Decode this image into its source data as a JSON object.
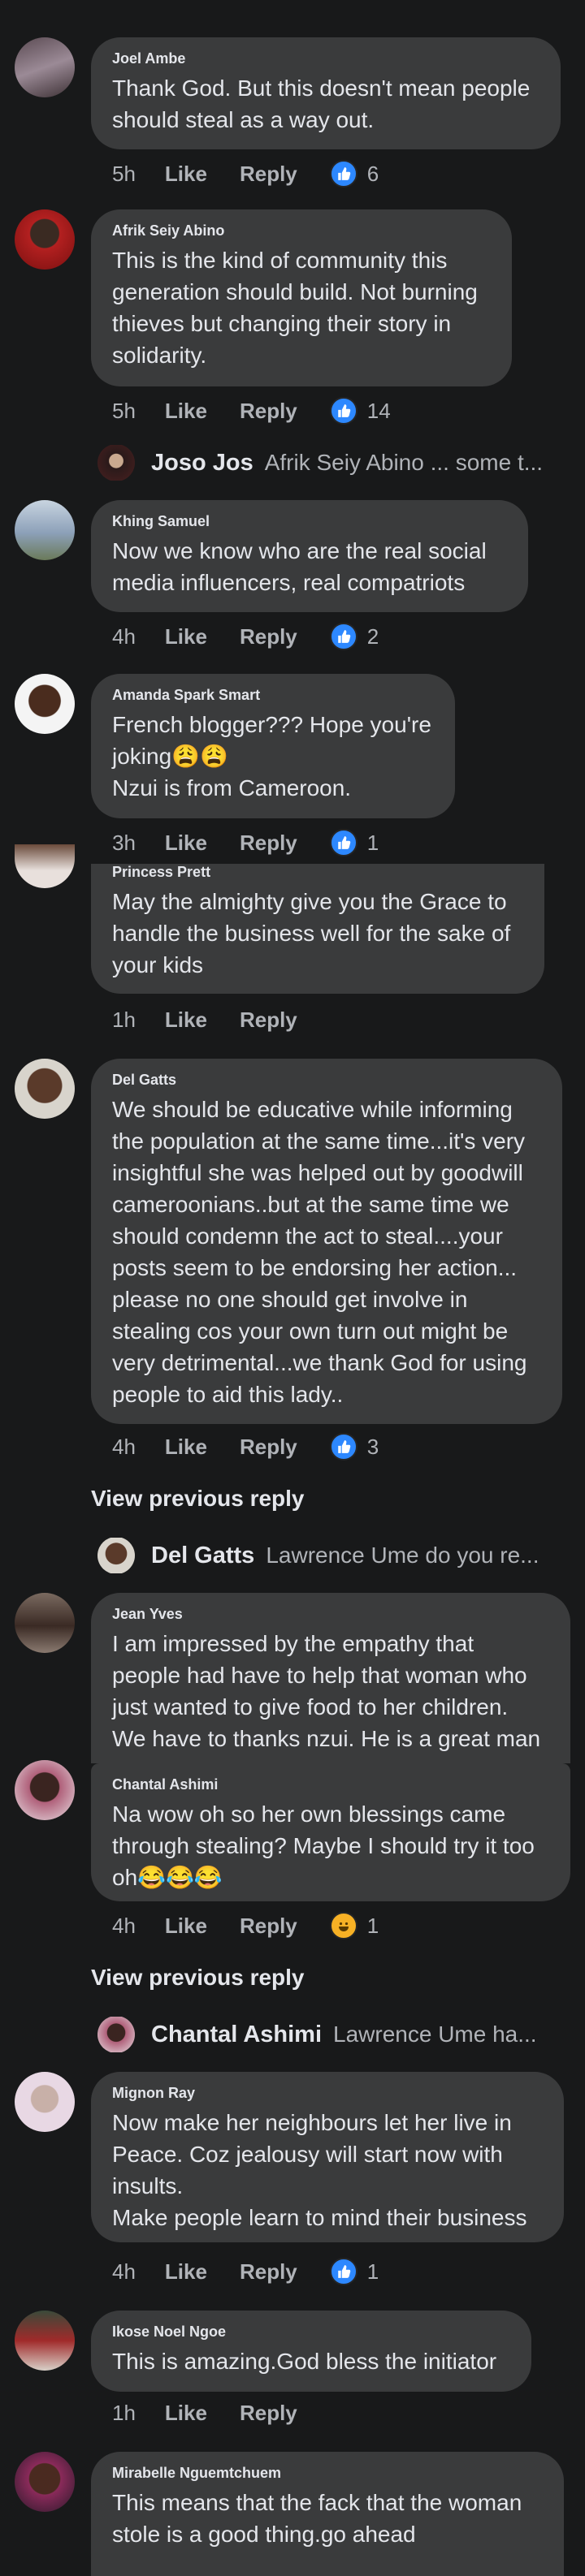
{
  "labels": {
    "like": "Like",
    "reply": "Reply"
  },
  "comments": [
    {
      "name": "Joel Ambe",
      "text": "Thank God. But this doesn't mean people\nshould steal as a way out.",
      "time": "5h",
      "reaction_count": "6"
    },
    {
      "name": "Afrik Seiy Abino",
      "text": "This is the kind of community this\ngeneration should build. Not burning\nthieves but changing their story in\nsolidarity.",
      "time": "5h",
      "reaction_count": "14"
    },
    {
      "name": "Khing Samuel",
      "text": "Now we know who are the real  social\nmedia influencers, real compatriots",
      "time": "4h",
      "reaction_count": "2"
    },
    {
      "name": "Amanda Spark Smart",
      "text": "French blogger??? Hope you're\njoking😩😩\nNzui is from Cameroon.",
      "time": "3h",
      "reaction_count": "1"
    },
    {
      "name": "Princess Prett",
      "text": "May the almighty give you the Grace to\nhandle the business well for the sake of\nyour kids",
      "time": "1h"
    },
    {
      "name": "Del Gatts",
      "text": "We should be educative while informing\nthe population at the same time...it's very\ninsightful she was helped out by goodwill\ncameroonians..but at the same time we\nshould condemn the act to steal....your\nposts seem to be endorsing her action...\nplease no one should get involve in\nstealing cos your own turn out might be\nvery detrimental...we thank God for using\npeople to aid this lady..",
      "time": "4h",
      "reaction_count": "3"
    },
    {
      "name": "Jean Yves",
      "text": "I am impressed by the empathy that\npeople had have to help that woman who\njust wanted to give food to her children.\nWe have to thanks nzui. He is a great man"
    },
    {
      "name": "Chantal Ashimi",
      "text": "Na wow oh so her own blessings came\nthrough stealing? Maybe I should try it too\noh😂😂😂",
      "time": "4h",
      "reaction_count": "1"
    },
    {
      "name": "Mignon Ray",
      "text": "Now make her neighbours let her live in\nPeace. Coz jealousy will start now with\ninsults.\nMake people learn to mind their business",
      "time": "4h",
      "reaction_count": "1"
    },
    {
      "name": "Ikose Noel Ngoe",
      "text": "This is amazing.God bless the initiator",
      "time": "1h"
    },
    {
      "name": "Mirabelle Nguemtchuem",
      "text": "This means that the fack that the woman\nstole is a good thing.go ahead"
    }
  ],
  "replies": [
    {
      "name": "Joso Jos",
      "text": "Afrik Seiy Abino ... some t..."
    },
    {
      "name": "Del Gatts",
      "text": "Lawrence Ume do you re..."
    },
    {
      "name": "Chantal Ashimi",
      "text": "Lawrence Ume  ha..."
    }
  ],
  "view_previous": "View previous reply",
  "colors": {
    "background": "#18191a",
    "bubble": "#3a3b3c",
    "like_blue": "#2d88ff"
  }
}
